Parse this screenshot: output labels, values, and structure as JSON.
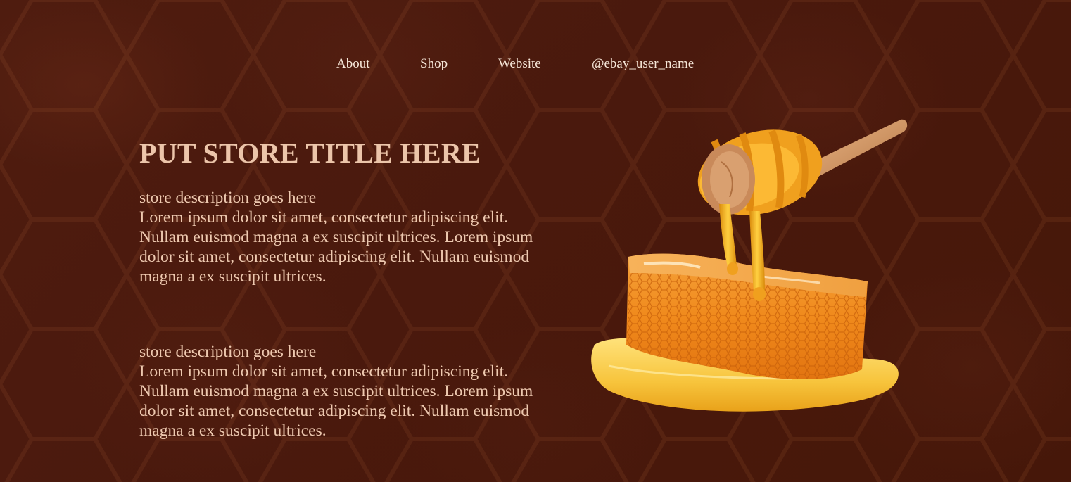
{
  "nav": {
    "about": "About",
    "shop": "Shop",
    "website": "Website",
    "user": "@ebay_user_name"
  },
  "store": {
    "title": "PUT STORE TITLE HERE",
    "sections": [
      {
        "heading": "store description goes here",
        "body": "Lorem ipsum dolor sit amet, consectetur adipiscing elit. Nullam euismod magna a ex suscipit ultrices. Lorem ipsum dolor sit amet, consectetur adipiscing elit. Nullam euismod magna a ex suscipit ultrices."
      },
      {
        "heading": "store description goes here",
        "body": "Lorem ipsum dolor sit amet, consectetur adipiscing elit. Nullam euismod magna a ex suscipit ultrices. Lorem ipsum dolor sit amet, consectetur adipiscing elit. Nullam euismod magna a ex suscipit ultrices."
      }
    ]
  },
  "colors": {
    "background": "#4a1a0e",
    "title": "#ecc5aa",
    "text": "#eec9b0",
    "nav": "#f6e6d8",
    "honey": "#f0a020"
  },
  "hero_image": "honeycomb-with-honey-dipper-image"
}
